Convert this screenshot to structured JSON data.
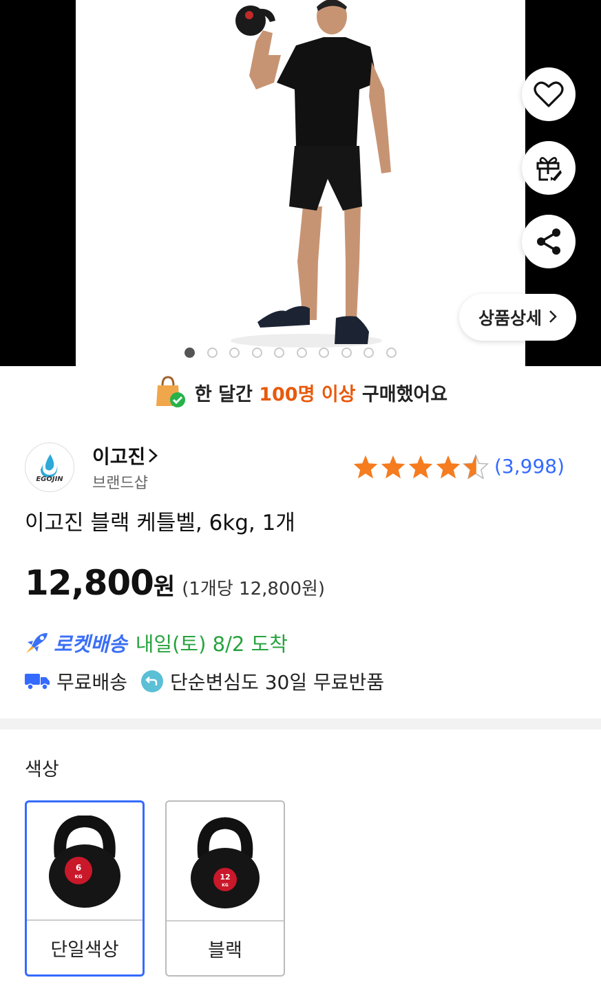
{
  "hero": {
    "detail_button_label": "상품상세",
    "slide_count": 10,
    "active_slide": 1
  },
  "banner": {
    "prefix": "한 달간",
    "highlight": "100명 이상",
    "suffix": "구매했어요",
    "highlight_color": "#e8590c"
  },
  "brand": {
    "name": "이고진",
    "subtitle": "브랜드샵",
    "logo_text": "EGOJIN"
  },
  "rating": {
    "stars": 4.5,
    "review_count": "(3,998)"
  },
  "product": {
    "title": "이고진 블랙 케틀벨, 6kg, 1개",
    "price": "12,800",
    "currency": "원",
    "unit_price": "(1개당 12,800원)"
  },
  "delivery": {
    "rocket_label": "로켓배송",
    "arrival": "내일(토) 8/2 도착",
    "free_shipping": "무료배송",
    "free_return": "단순변심도 30일 무료반품"
  },
  "options": {
    "label": "색상",
    "items": [
      {
        "label": "단일색상",
        "weight": "6",
        "unit": "KG",
        "selected": true
      },
      {
        "label": "블랙",
        "weight": "12",
        "unit": "KG",
        "selected": false
      }
    ]
  },
  "colors": {
    "accent_blue": "#346aff",
    "rocket_green": "#27a33f",
    "star_orange": "#f57c1f"
  }
}
